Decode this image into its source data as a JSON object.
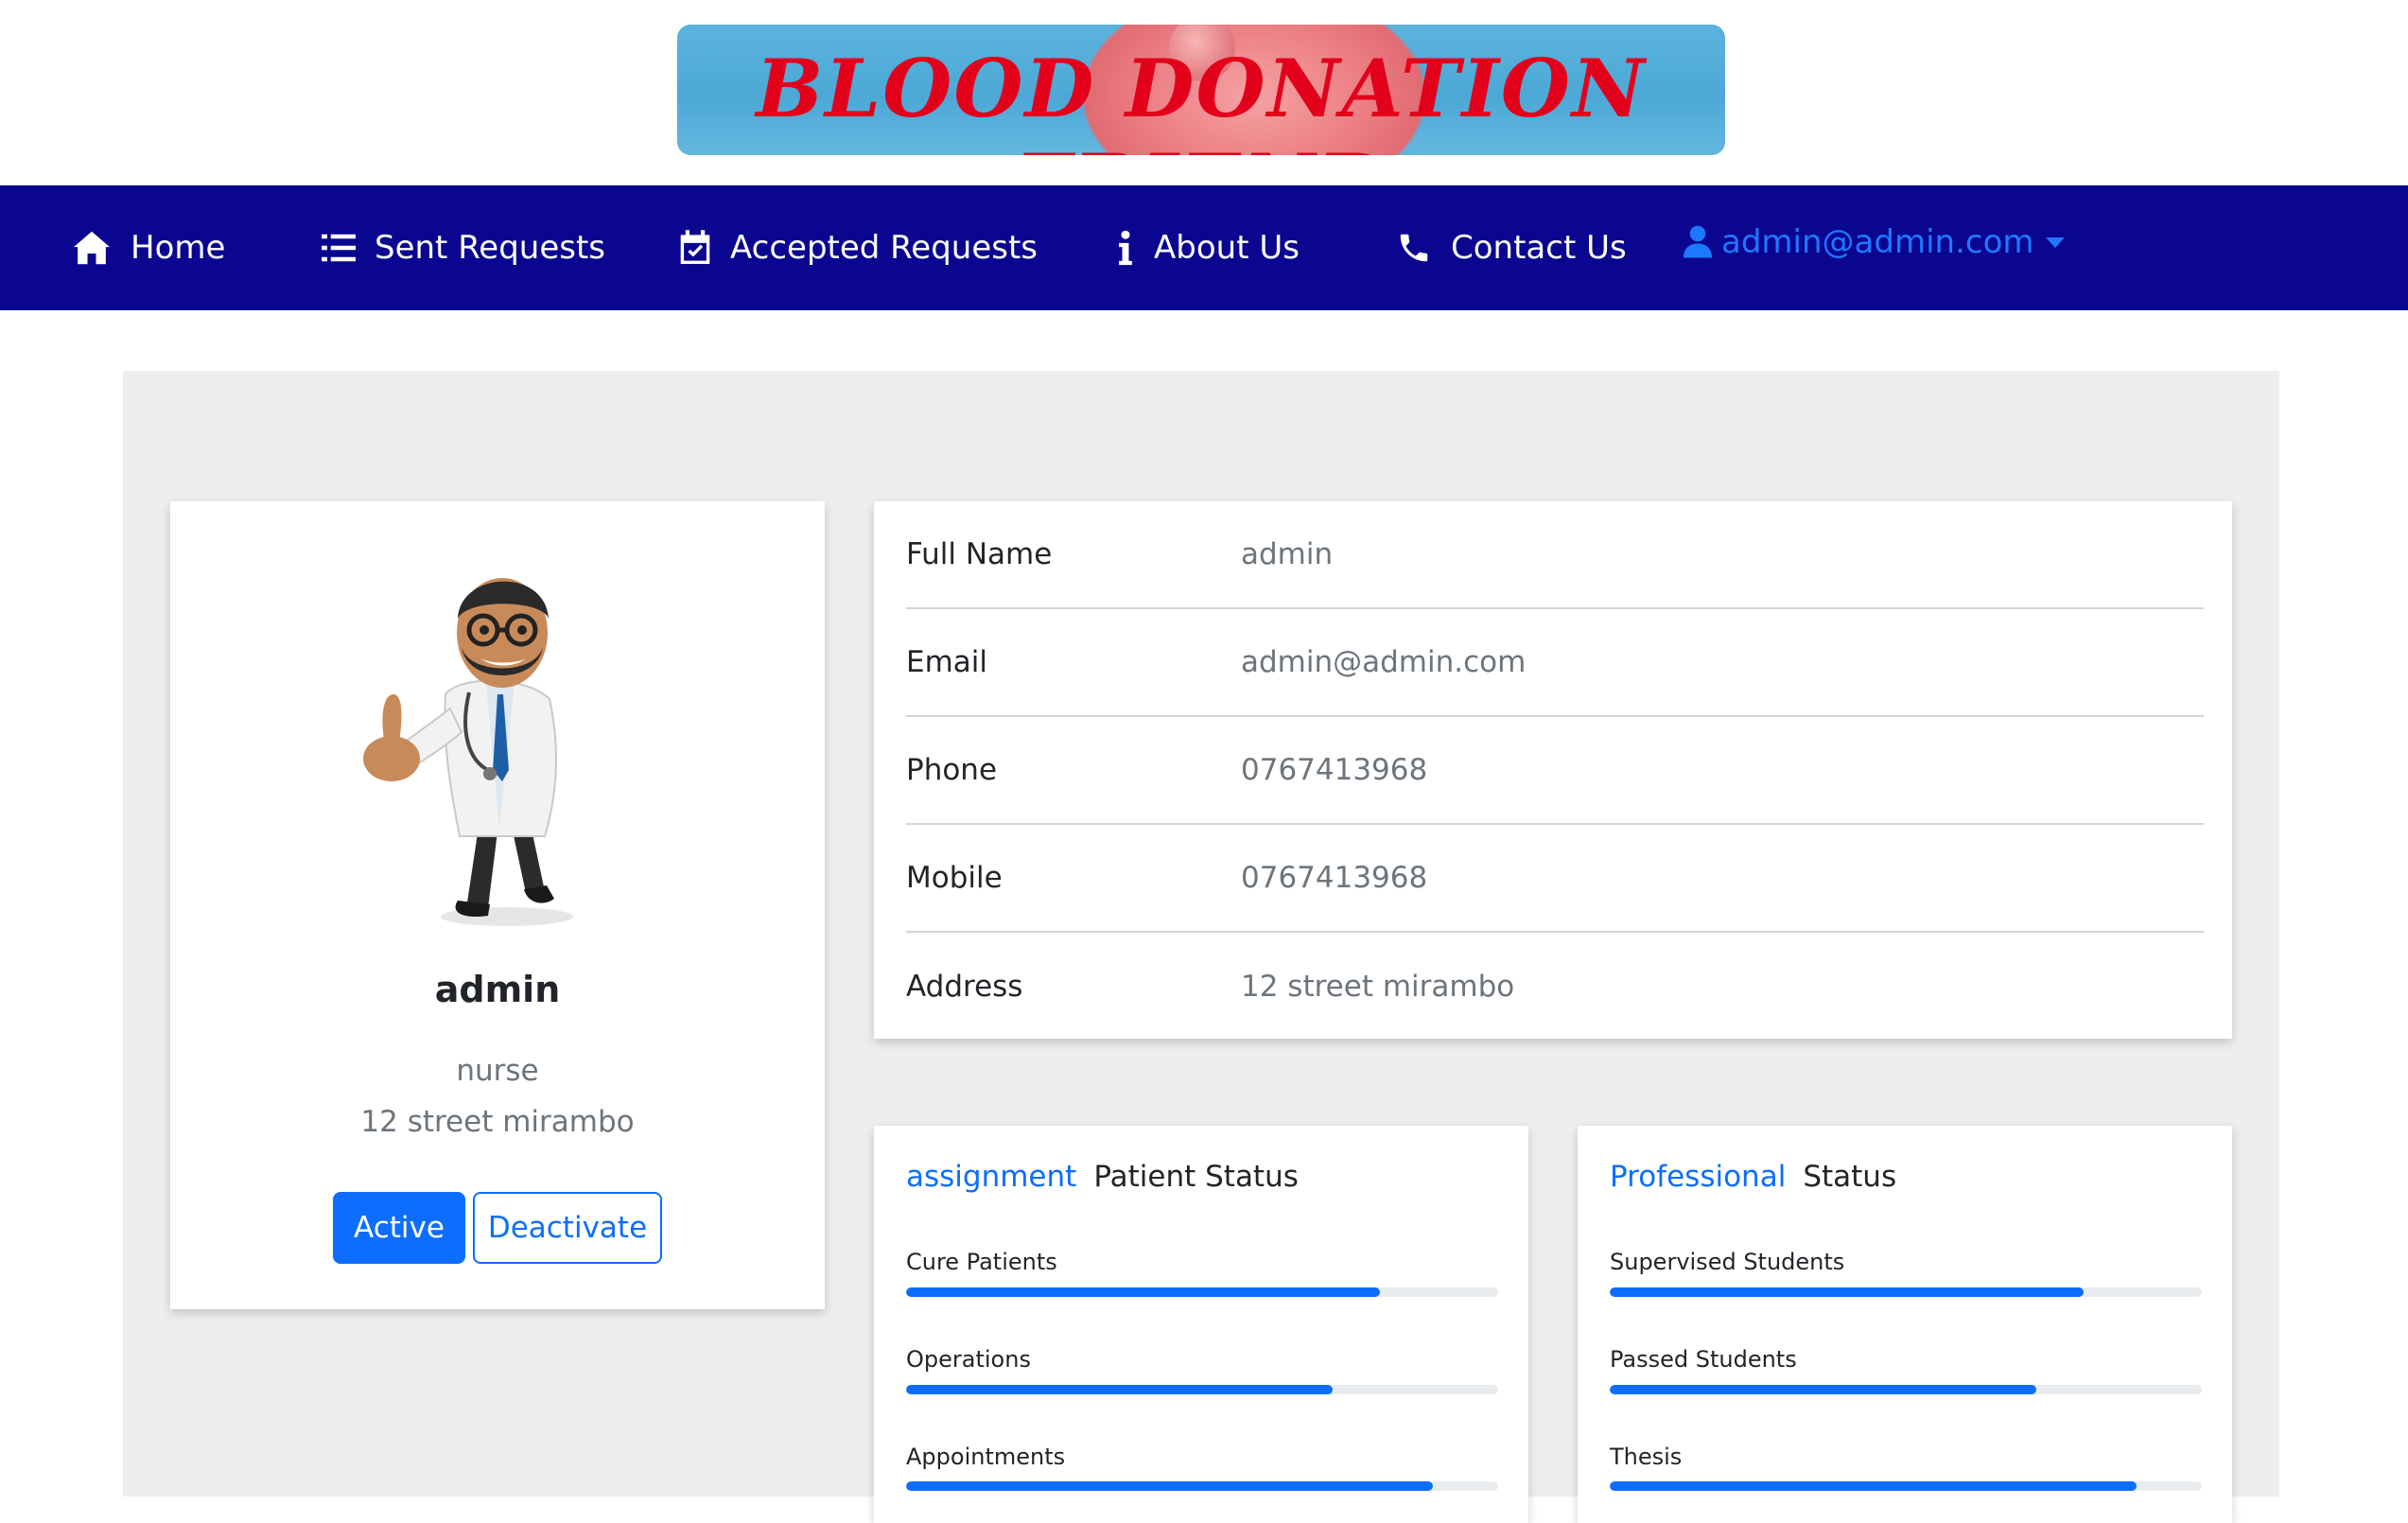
{
  "banner": {
    "title": "BLOOD DONATION FRIEND"
  },
  "nav": {
    "items": [
      {
        "label": "Home",
        "icon": "home-icon"
      },
      {
        "label": "Sent Requests",
        "icon": "list-icon"
      },
      {
        "label": "Accepted Requests",
        "icon": "calendar-check-icon"
      },
      {
        "label": "About Us",
        "icon": "info-icon"
      },
      {
        "label": "Contact Us",
        "icon": "phone-icon"
      }
    ],
    "user": {
      "email": "admin@admin.com",
      "icon": "user-icon"
    }
  },
  "profile": {
    "name": "admin",
    "role": "nurse",
    "address": "12 street mirambo",
    "active_label": "Active",
    "deactivate_label": "Deactivate",
    "avatar_icon": "doctor-avatar"
  },
  "details": [
    {
      "label": "Full Name",
      "value": "admin"
    },
    {
      "label": "Email",
      "value": "admin@admin.com"
    },
    {
      "label": "Phone",
      "value": "0767413968"
    },
    {
      "label": "Mobile",
      "value": "0767413968"
    },
    {
      "label": "Address",
      "value": "12 street mirambo"
    }
  ],
  "patient_status": {
    "accent": "assignment",
    "title": "Patient Status",
    "bars": [
      {
        "label": "Cure Patients",
        "percent": 80
      },
      {
        "label": "Operations",
        "percent": 72
      },
      {
        "label": "Appointments",
        "percent": 89
      }
    ]
  },
  "professional_status": {
    "accent": "Professional",
    "title": "Status",
    "bars": [
      {
        "label": "Supervised Students",
        "percent": 80
      },
      {
        "label": "Passed Students",
        "percent": 72
      },
      {
        "label": "Thesis",
        "percent": 89
      }
    ]
  },
  "colors": {
    "navbar": "#0b0690",
    "primary": "#0d6efd",
    "banner_text": "#e3001b",
    "page_bg": "#eeeeee"
  }
}
